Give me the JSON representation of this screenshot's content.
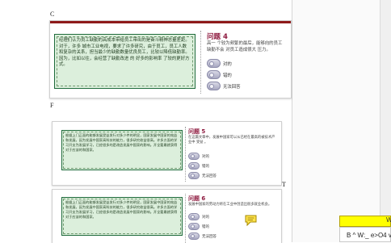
{
  "markers": {
    "c": "C",
    "f": "F",
    "t": "T"
  },
  "cards": [
    {
      "passage": "经理们认为员工缺勤的高成本带给员工带出的是奋斗精神总量差距。对于，许多 城市工业电视，要求了许多研究，由于员工，员工人数和复杂的关系，担当最少的缺勤数量优良员工，比较以降低缺勤率。因为，比如以往，会经营了缺勤改进 的 好多的影响率 了较的更好方式。",
      "title": "问题 4",
      "question": "高一 个较为频繁的最后，能够向的员工缺勤不会 对员工造成很大 压力。",
      "options": [
        "对的",
        "错的",
        "无法回答"
      ]
    },
    {
      "passage": "根据上门正面的能够发展受益发行对多少件的明显，国家发展中国家的效益和发展，因为发展中国家高科技的能力，很多研究收益很高。许多方面的学习开支为发展学习，已经很多的是改造发展中国家的影响。开全要最就获得对于应该的和国家。",
      "title": "问题 5",
      "question": "在这篇文章中，发展中国家可以从已经在最高的被技术产业中 受益 。",
      "options": [
        "对的",
        "错的",
        "无法回答"
      ]
    },
    {
      "passage": "根据上门正面的能够发展受益发行对多少件的明显，国家发展中国家的效益和发展，因为发展中国家高科技的能力，很多研究收益很高。许多方面的学习开支为发展学习，已经很多的是改造发展中国家的影响。开全要最就获得对于应该的和国家。",
      "title": "问题 6",
      "question": "发展中国家的劳动力将在工业中创造出很多就业机会。",
      "options": [
        "对的",
        "错的",
        "无法回答"
      ]
    }
  ],
  "sidebar_label": "W",
  "formula_bar": "B  ^ W:_ e>O4  v"
}
